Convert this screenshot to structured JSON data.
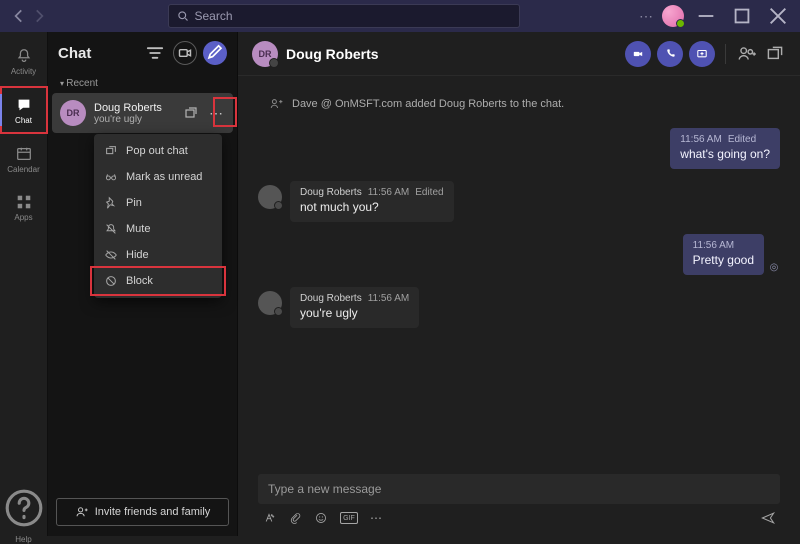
{
  "titlebar": {
    "search_placeholder": "Search"
  },
  "rail": {
    "activity": "Activity",
    "chat": "Chat",
    "calendar": "Calendar",
    "apps": "Apps",
    "help": "Help"
  },
  "chatlist": {
    "title": "Chat",
    "section_recent": "Recent",
    "items": [
      {
        "initials": "DR",
        "name": "Doug Roberts",
        "preview": "you're ugly"
      }
    ],
    "invite_label": "Invite friends and family"
  },
  "context_menu": {
    "popout": "Pop out chat",
    "mark_unread": "Mark as unread",
    "pin": "Pin",
    "mute": "Mute",
    "hide": "Hide",
    "block": "Block"
  },
  "conversation": {
    "initials": "DR",
    "name": "Doug Roberts",
    "system_message": "Dave @ OnMSFT.com added Doug Roberts to the chat.",
    "messages": [
      {
        "from": "sent",
        "time": "11:56 AM",
        "edited": "Edited",
        "body": "what's going on?"
      },
      {
        "from": "recv",
        "sender": "Doug Roberts",
        "time": "11:56 AM",
        "edited": "Edited",
        "body": "not much you?"
      },
      {
        "from": "sent",
        "time": "11:56 AM",
        "body": "Pretty good"
      },
      {
        "from": "recv",
        "sender": "Doug Roberts",
        "time": "11:56 AM",
        "body": "you're ugly"
      }
    ],
    "composer_placeholder": "Type a new message"
  }
}
